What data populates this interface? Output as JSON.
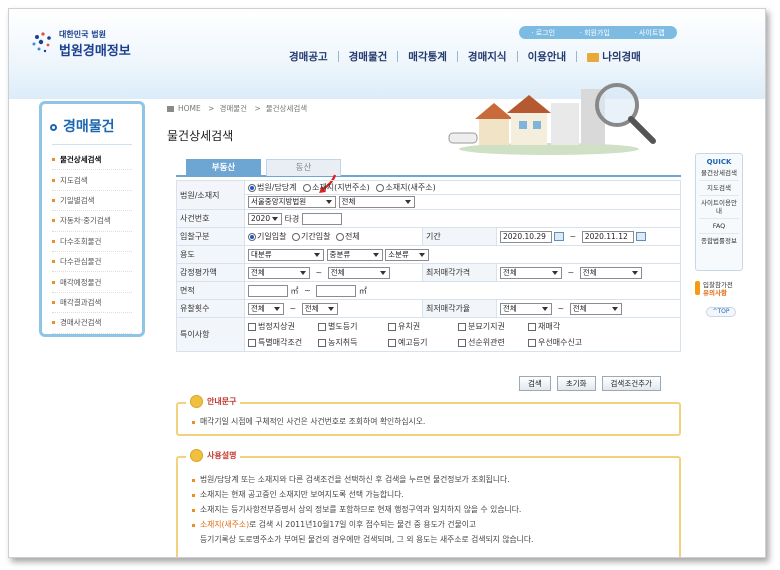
{
  "header": {
    "logo_small": "대한민국 법원",
    "logo_big": "법원경매정보",
    "util": [
      "· 로그인",
      "· 회원가입",
      "· 사이트맵"
    ],
    "gnb": [
      "경매공고",
      "경매물건",
      "매각통계",
      "경매지식",
      "이용안내",
      "나의경매"
    ]
  },
  "sidebar": {
    "title": "경매물건",
    "items": [
      "물건상세검색",
      "지도검색",
      "기일별검색",
      "자동차·중기검색",
      "다수조회물건",
      "다수관심물건",
      "매각예정물건",
      "매각결과검색",
      "경매사건검색"
    ]
  },
  "breadcrumb": {
    "home": "HOME",
    "sep1": ">",
    "l1": "경매물건",
    "sep2": ">",
    "l2": "물건상세검색"
  },
  "page_title": "물건상세검색",
  "tabs": [
    "부동산",
    "동산"
  ],
  "form": {
    "court_label": "법원/소재지",
    "court_opts": [
      "법원/담당계",
      "소재지(지번주소)",
      "소재지(새주소)"
    ],
    "court_select": "서울중앙지방법원",
    "court_select2": "전체",
    "case_label": "사건번호",
    "case_year": "2020",
    "case_type": "타경",
    "bid_label": "입찰구분",
    "bid_opts": [
      "기일입찰",
      "기간입찰",
      "전체"
    ],
    "period_label": "기간",
    "date_from": "2020.10.29",
    "date_to": "2020.11.12",
    "tilde": "~",
    "use_label": "용도",
    "use_sel": [
      "대분류",
      "중분류",
      "소분류"
    ],
    "appraisal_label": "감정평가액",
    "min_price_label": "최저매각가격",
    "all": "전체",
    "area_label": "면적",
    "area_unit": "㎡",
    "fail_label": "유찰횟수",
    "min_rate_label": "최저매각가율",
    "special_label": "특이사항",
    "special_items": [
      "법정지상권",
      "별도등기",
      "유치권",
      "분묘기지권",
      "재매각",
      "특별매각조건",
      "농지취득",
      "예고등기",
      "선순위관련",
      "우선매수신고"
    ]
  },
  "buttons": [
    "검색",
    "초기화",
    "검색조건추가"
  ],
  "guide": {
    "title": "안내문구",
    "text": "매각기일 시점에 구체적인 사건은 사건번호로 조회하여 확인하십시오."
  },
  "usage": {
    "title": "사용설명",
    "lines": [
      "법원/담당계 또는 소재지와 다른 검색조건을 선택하신 후 검색을 누르면 물건정보가 조회됩니다.",
      "소재지는 현재 공고중인 소재지만 보여지도록 선택 가능합니다.",
      "소재지는 등기사항전부증명서 상의 정보를 포함하므로 현재 행정구역과 일치하지 않을 수 있습니다."
    ],
    "line4_hl": "소재지(새주소)",
    "line4_rest": "로 검색 시 2011년10월17일 이후 접수되는 물건 중 용도가 건물이고",
    "line5": "등기기록상 도로명주소가 부여된 물건의 경우에만 검색되며, 그 외 용도는 새주소로 검색되지 않습니다."
  },
  "quick": {
    "title": "QUICK",
    "items": [
      "물건상세검색",
      "지도검색",
      "사이트이용안내",
      "FAQ",
      "종합법률정보"
    ]
  },
  "notice": {
    "l1": "입찰참가전",
    "l2": "유의사항"
  },
  "top": "^TOP"
}
